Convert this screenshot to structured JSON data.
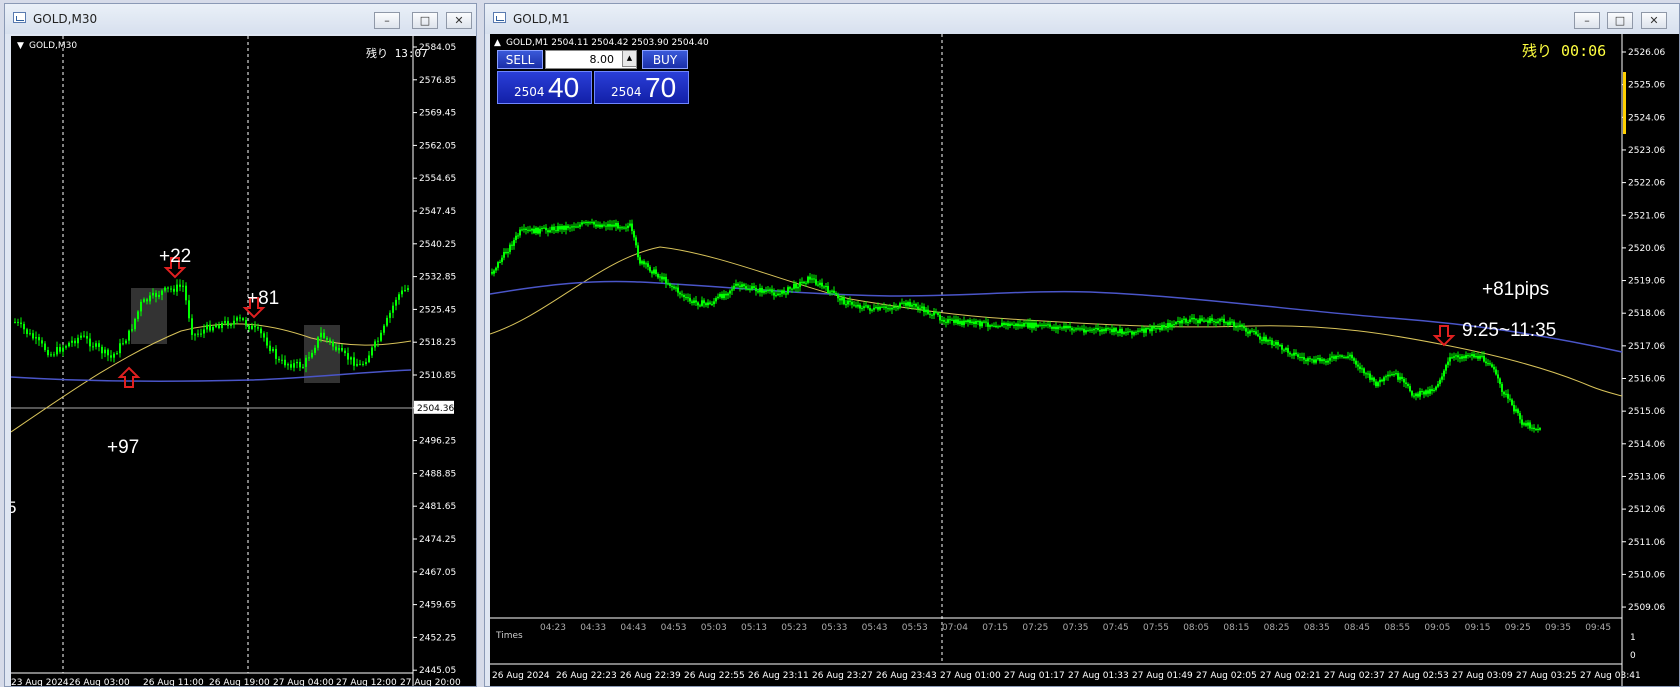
{
  "windows": {
    "left": {
      "title": "GOLD,M30",
      "symbol_label": "GOLD,M30",
      "remain": "残り 13:07"
    },
    "right": {
      "title": "GOLD,M1",
      "symbol_label": "GOLD,M1  2504.11 2504.42 2503.90 2504.40",
      "remain": "残り 00:06"
    }
  },
  "window_buttons": {
    "minimize": "–",
    "maximize": "□",
    "close": "✕"
  },
  "left_chart": {
    "price_labels": [
      "2584.05",
      "2576.85",
      "2569.45",
      "2562.05",
      "2554.65",
      "2547.45",
      "2540.25",
      "2532.85",
      "2525.45",
      "2518.25",
      "2510.85",
      "2504.36",
      "2496.25",
      "2488.85",
      "2481.65",
      "2474.25",
      "2467.05",
      "2459.65",
      "2452.25",
      "2445.05"
    ],
    "time_labels": [
      "23 Aug 2024",
      "26 Aug 03:00",
      "26 Aug 11:00",
      "26 Aug 19:00",
      "27 Aug 04:00",
      "27 Aug 12:00",
      "27 Aug 20:00"
    ],
    "current_price": "2504.36",
    "annotations": [
      "+22",
      "+81",
      "+97"
    ],
    "edge_glyph": "5"
  },
  "right_chart": {
    "price_labels": [
      "2526.06",
      "2525.06",
      "2524.06",
      "2523.06",
      "2522.06",
      "2521.06",
      "2520.06",
      "2519.06",
      "2518.06",
      "2517.06",
      "2516.06",
      "2515.06",
      "2514.06",
      "2513.06",
      "2512.06",
      "2511.06",
      "2510.06",
      "2509.06"
    ],
    "top_time_labels": [
      "04:23",
      "04:33",
      "04:43",
      "04:53",
      "05:03",
      "05:13",
      "05:23",
      "05:33",
      "05:43",
      "05:53",
      "07:04",
      "07:15",
      "07:25",
      "07:35",
      "07:45",
      "07:55",
      "08:05",
      "08:15",
      "08:25",
      "08:35",
      "08:45",
      "08:55",
      "09:05",
      "09:15",
      "09:25",
      "09:35",
      "09:45"
    ],
    "bottom_time_labels": [
      "26 Aug 2024",
      "26 Aug 22:23",
      "26 Aug 22:39",
      "26 Aug 22:55",
      "26 Aug 23:11",
      "26 Aug 23:27",
      "26 Aug 23:43",
      "27 Aug 01:00",
      "27 Aug 01:17",
      "27 Aug 01:33",
      "27 Aug 01:49",
      "27 Aug 02:05",
      "27 Aug 02:21",
      "27 Aug 02:37",
      "27 Aug 02:53",
      "27 Aug 03:09",
      "27 Aug 03:25",
      "27 Aug 03:41"
    ],
    "sub_label": "Times",
    "sub_scale": [
      "1",
      "0"
    ],
    "annotations": [
      "+81pips",
      "9:25~11:35"
    ]
  },
  "trade_panel": {
    "sell_label": "SELL",
    "buy_label": "BUY",
    "lot": "8.00",
    "sell_small": "2504",
    "sell_big": "40",
    "buy_small": "2504",
    "buy_big": "70"
  },
  "colors": {
    "candle": "#00ff00",
    "ma_fast": "#d8c35a",
    "ma_slow": "#4a55c8",
    "arrow": "#e02020",
    "background": "#000000"
  }
}
